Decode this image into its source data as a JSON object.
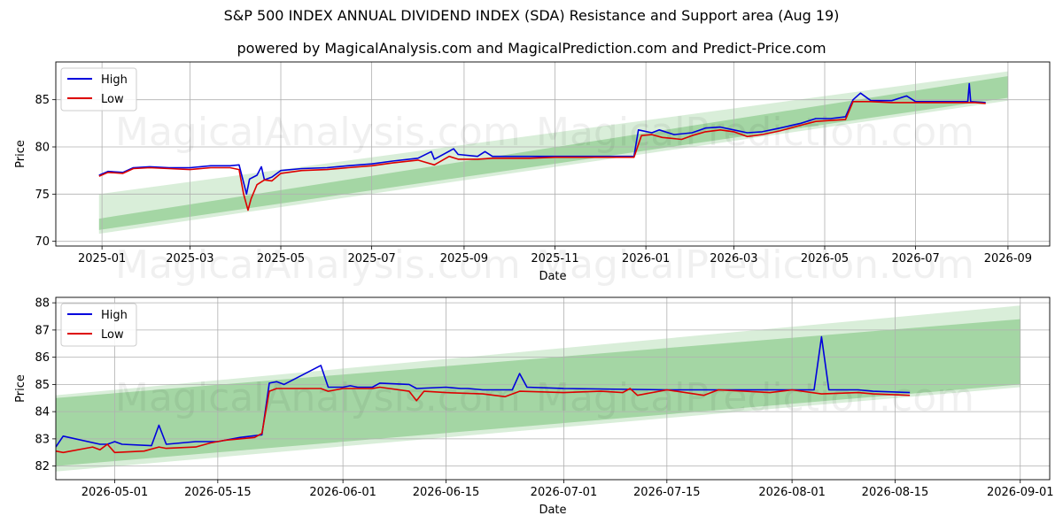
{
  "title": "S&P 500 INDEX ANNUAL DIVIDEND INDEX (SDA) Resistance and Support area (Aug 19)",
  "subtitle": "powered by MagicalAnalysis.com and MagicalPrediction.com and Predict-Price.com",
  "watermarks": [
    "MagicalAnalysis.com",
    "MagicalPrediction.com"
  ],
  "colors": {
    "high": "#0000dd",
    "low": "#dd0000",
    "band": "#2ca02c",
    "grid": "#b0b0b0"
  },
  "chart_data": [
    {
      "type": "line",
      "xlabel": "Date",
      "ylabel": "Price",
      "xlim": [
        "2024-12-01",
        "2026-09-29"
      ],
      "ylim": [
        69.5,
        89
      ],
      "xticks": [
        {
          "date": "2025-01-01",
          "label": "2025-01"
        },
        {
          "date": "2025-03-01",
          "label": "2025-03"
        },
        {
          "date": "2025-05-01",
          "label": "2025-05"
        },
        {
          "date": "2025-07-01",
          "label": "2025-07"
        },
        {
          "date": "2025-09-01",
          "label": "2025-09"
        },
        {
          "date": "2025-11-01",
          "label": "2025-11"
        },
        {
          "date": "2026-01-01",
          "label": "2026-01"
        },
        {
          "date": "2026-03-01",
          "label": "2026-03"
        },
        {
          "date": "2026-05-01",
          "label": "2026-05"
        },
        {
          "date": "2026-07-01",
          "label": "2026-07"
        },
        {
          "date": "2026-09-01",
          "label": "2026-09"
        }
      ],
      "yticks": [
        70,
        75,
        80,
        85
      ],
      "grid": true,
      "legend": "top-left",
      "bands": [
        {
          "x": [
            "2024-12-30",
            "2026-09-01"
          ],
          "upper": [
            75.0,
            88.0
          ],
          "lower": [
            70.8,
            84.9
          ],
          "opacity": 0.18
        },
        {
          "x": [
            "2024-12-30",
            "2026-09-01"
          ],
          "upper": [
            72.4,
            87.5
          ],
          "lower": [
            71.2,
            85.2
          ],
          "opacity": 0.3
        }
      ],
      "series": [
        {
          "name": "High",
          "points": [
            [
              "2024-12-30",
              77.0
            ],
            [
              "2025-01-05",
              77.4
            ],
            [
              "2025-01-15",
              77.3
            ],
            [
              "2025-01-22",
              77.8
            ],
            [
              "2025-02-02",
              77.9
            ],
            [
              "2025-02-15",
              77.8
            ],
            [
              "2025-03-01",
              77.8
            ],
            [
              "2025-03-15",
              78.0
            ],
            [
              "2025-03-28",
              78.0
            ],
            [
              "2025-04-03",
              78.1
            ],
            [
              "2025-04-08",
              75.0
            ],
            [
              "2025-04-10",
              76.6
            ],
            [
              "2025-04-15",
              77.0
            ],
            [
              "2025-04-18",
              77.9
            ],
            [
              "2025-04-20",
              76.5
            ],
            [
              "2025-04-25",
              76.8
            ],
            [
              "2025-05-01",
              77.5
            ],
            [
              "2025-05-15",
              77.7
            ],
            [
              "2025-06-01",
              77.8
            ],
            [
              "2025-06-15",
              78.0
            ],
            [
              "2025-07-01",
              78.2
            ],
            [
              "2025-07-15",
              78.5
            ],
            [
              "2025-08-01",
              78.8
            ],
            [
              "2025-08-10",
              79.5
            ],
            [
              "2025-08-12",
              78.7
            ],
            [
              "2025-08-25",
              79.8
            ],
            [
              "2025-08-28",
              79.2
            ],
            [
              "2025-09-10",
              79.0
            ],
            [
              "2025-09-15",
              79.5
            ],
            [
              "2025-09-20",
              79.0
            ],
            [
              "2025-10-15",
              79.0
            ],
            [
              "2025-11-01",
              79.0
            ],
            [
              "2025-11-15",
              79.0
            ],
            [
              "2025-12-01",
              79.0
            ],
            [
              "2025-12-15",
              79.0
            ],
            [
              "2025-12-24",
              79.0
            ],
            [
              "2025-12-27",
              81.8
            ],
            [
              "2026-01-05",
              81.5
            ],
            [
              "2026-01-10",
              81.8
            ],
            [
              "2026-01-20",
              81.3
            ],
            [
              "2026-02-01",
              81.5
            ],
            [
              "2026-02-10",
              82.0
            ],
            [
              "2026-02-20",
              82.1
            ],
            [
              "2026-03-01",
              81.8
            ],
            [
              "2026-03-10",
              81.5
            ],
            [
              "2026-03-20",
              81.6
            ],
            [
              "2026-04-01",
              82.0
            ],
            [
              "2026-04-15",
              82.5
            ],
            [
              "2026-04-25",
              83.0
            ],
            [
              "2026-05-05",
              83.0
            ],
            [
              "2026-05-15",
              83.2
            ],
            [
              "2026-05-20",
              85.0
            ],
            [
              "2026-05-25",
              85.7
            ],
            [
              "2026-06-01",
              84.9
            ],
            [
              "2026-06-15",
              84.9
            ],
            [
              "2026-06-25",
              85.4
            ],
            [
              "2026-07-01",
              84.8
            ],
            [
              "2026-07-15",
              84.8
            ],
            [
              "2026-08-01",
              84.8
            ],
            [
              "2026-08-05",
              84.8
            ],
            [
              "2026-08-06",
              86.7
            ],
            [
              "2026-08-07",
              84.8
            ],
            [
              "2026-08-17",
              84.7
            ]
          ]
        },
        {
          "name": "Low",
          "points": [
            [
              "2024-12-30",
              76.9
            ],
            [
              "2025-01-05",
              77.3
            ],
            [
              "2025-01-15",
              77.2
            ],
            [
              "2025-01-22",
              77.7
            ],
            [
              "2025-02-02",
              77.8
            ],
            [
              "2025-02-15",
              77.7
            ],
            [
              "2025-03-01",
              77.6
            ],
            [
              "2025-03-15",
              77.8
            ],
            [
              "2025-03-28",
              77.8
            ],
            [
              "2025-04-03",
              77.6
            ],
            [
              "2025-04-06",
              75.0
            ],
            [
              "2025-04-09",
              73.3
            ],
            [
              "2025-04-11",
              74.5
            ],
            [
              "2025-04-15",
              76.0
            ],
            [
              "2025-04-20",
              76.5
            ],
            [
              "2025-04-25",
              76.4
            ],
            [
              "2025-05-01",
              77.2
            ],
            [
              "2025-05-15",
              77.5
            ],
            [
              "2025-06-01",
              77.6
            ],
            [
              "2025-06-15",
              77.8
            ],
            [
              "2025-07-01",
              78.0
            ],
            [
              "2025-07-15",
              78.3
            ],
            [
              "2025-08-01",
              78.6
            ],
            [
              "2025-08-12",
              78.1
            ],
            [
              "2025-08-22",
              79.0
            ],
            [
              "2025-08-28",
              78.7
            ],
            [
              "2025-09-10",
              78.7
            ],
            [
              "2025-09-20",
              78.8
            ],
            [
              "2025-10-15",
              78.8
            ],
            [
              "2025-11-01",
              78.9
            ],
            [
              "2025-11-15",
              78.9
            ],
            [
              "2025-12-01",
              78.9
            ],
            [
              "2025-12-15",
              78.9
            ],
            [
              "2025-12-24",
              78.9
            ],
            [
              "2025-12-29",
              81.2
            ],
            [
              "2026-01-05",
              81.3
            ],
            [
              "2026-01-12",
              81.0
            ],
            [
              "2026-01-25",
              80.8
            ],
            [
              "2026-02-01",
              81.2
            ],
            [
              "2026-02-10",
              81.6
            ],
            [
              "2026-02-20",
              81.8
            ],
            [
              "2026-03-01",
              81.6
            ],
            [
              "2026-03-10",
              81.1
            ],
            [
              "2026-03-20",
              81.3
            ],
            [
              "2026-04-01",
              81.7
            ],
            [
              "2026-04-15",
              82.3
            ],
            [
              "2026-04-25",
              82.7
            ],
            [
              "2026-05-05",
              82.8
            ],
            [
              "2026-05-15",
              82.9
            ],
            [
              "2026-05-20",
              84.8
            ],
            [
              "2026-06-01",
              84.8
            ],
            [
              "2026-06-15",
              84.7
            ],
            [
              "2026-07-01",
              84.7
            ],
            [
              "2026-07-15",
              84.7
            ],
            [
              "2026-08-01",
              84.7
            ],
            [
              "2026-08-10",
              84.7
            ],
            [
              "2026-08-17",
              84.6
            ]
          ]
        }
      ]
    },
    {
      "type": "line",
      "xlabel": "Date",
      "ylabel": "Price",
      "xlim": [
        "2026-04-23",
        "2026-09-05"
      ],
      "ylim": [
        81.5,
        88.2
      ],
      "xticks": [
        {
          "date": "2026-05-01",
          "label": "2026-05-01"
        },
        {
          "date": "2026-05-15",
          "label": "2026-05-15"
        },
        {
          "date": "2026-06-01",
          "label": "2026-06-01"
        },
        {
          "date": "2026-06-15",
          "label": "2026-06-15"
        },
        {
          "date": "2026-07-01",
          "label": "2026-07-01"
        },
        {
          "date": "2026-07-15",
          "label": "2026-07-15"
        },
        {
          "date": "2026-08-01",
          "label": "2026-08-01"
        },
        {
          "date": "2026-08-15",
          "label": "2026-08-15"
        },
        {
          "date": "2026-09-01",
          "label": "2026-09-01"
        }
      ],
      "yticks": [
        82,
        83,
        84,
        85,
        86,
        87,
        88
      ],
      "grid": true,
      "legend": "top-left",
      "bands": [
        {
          "x": [
            "2026-04-23",
            "2026-09-01"
          ],
          "upper": [
            84.6,
            87.9
          ],
          "lower": [
            81.8,
            84.9
          ],
          "opacity": 0.18
        },
        {
          "x": [
            "2026-04-23",
            "2026-09-01"
          ],
          "upper": [
            84.5,
            87.4
          ],
          "lower": [
            82.0,
            85.0
          ],
          "opacity": 0.3
        }
      ],
      "series": [
        {
          "name": "High",
          "points": [
            [
              "2026-04-23",
              82.7
            ],
            [
              "2026-04-24",
              83.1
            ],
            [
              "2026-04-29",
              82.8
            ],
            [
              "2026-04-30",
              82.8
            ],
            [
              "2026-05-01",
              82.9
            ],
            [
              "2026-05-02",
              82.8
            ],
            [
              "2026-05-06",
              82.75
            ],
            [
              "2026-05-07",
              83.5
            ],
            [
              "2026-05-08",
              82.8
            ],
            [
              "2026-05-12",
              82.9
            ],
            [
              "2026-05-15",
              82.9
            ],
            [
              "2026-05-18",
              83.05
            ],
            [
              "2026-05-21",
              83.15
            ],
            [
              "2026-05-22",
              85.05
            ],
            [
              "2026-05-23",
              85.1
            ],
            [
              "2026-05-24",
              85.0
            ],
            [
              "2026-05-29",
              85.7
            ],
            [
              "2026-05-30",
              84.9
            ],
            [
              "2026-06-01",
              84.9
            ],
            [
              "2026-06-02",
              84.95
            ],
            [
              "2026-06-03",
              84.9
            ],
            [
              "2026-06-05",
              84.9
            ],
            [
              "2026-06-06",
              85.05
            ],
            [
              "2026-06-10",
              85.0
            ],
            [
              "2026-06-11",
              84.85
            ],
            [
              "2026-06-15",
              84.9
            ],
            [
              "2026-06-17",
              84.85
            ],
            [
              "2026-06-18",
              84.85
            ],
            [
              "2026-06-20",
              84.8
            ],
            [
              "2026-06-24",
              84.8
            ],
            [
              "2026-06-25",
              85.4
            ],
            [
              "2026-06-26",
              84.9
            ],
            [
              "2026-07-01",
              84.85
            ],
            [
              "2026-07-15",
              84.8
            ],
            [
              "2026-08-01",
              84.8
            ],
            [
              "2026-08-04",
              84.8
            ],
            [
              "2026-08-05",
              86.75
            ],
            [
              "2026-08-06",
              84.8
            ],
            [
              "2026-08-10",
              84.8
            ],
            [
              "2026-08-12",
              84.75
            ],
            [
              "2026-08-17",
              84.7
            ]
          ]
        },
        {
          "name": "Low",
          "points": [
            [
              "2026-04-23",
              82.55
            ],
            [
              "2026-04-24",
              82.5
            ],
            [
              "2026-04-28",
              82.7
            ],
            [
              "2026-04-29",
              82.6
            ],
            [
              "2026-04-30",
              82.8
            ],
            [
              "2026-05-01",
              82.5
            ],
            [
              "2026-05-05",
              82.55
            ],
            [
              "2026-05-07",
              82.7
            ],
            [
              "2026-05-08",
              82.65
            ],
            [
              "2026-05-12",
              82.7
            ],
            [
              "2026-05-14",
              82.85
            ],
            [
              "2026-05-16",
              82.95
            ],
            [
              "2026-05-20",
              83.05
            ],
            [
              "2026-05-21",
              83.2
            ],
            [
              "2026-05-22",
              84.75
            ],
            [
              "2026-05-23",
              84.85
            ],
            [
              "2026-05-29",
              84.85
            ],
            [
              "2026-05-30",
              84.75
            ],
            [
              "2026-06-01",
              84.85
            ],
            [
              "2026-06-05",
              84.85
            ],
            [
              "2026-06-06",
              84.9
            ],
            [
              "2026-06-10",
              84.75
            ],
            [
              "2026-06-11",
              84.4
            ],
            [
              "2026-06-12",
              84.75
            ],
            [
              "2026-06-15",
              84.7
            ],
            [
              "2026-06-20",
              84.65
            ],
            [
              "2026-06-23",
              84.55
            ],
            [
              "2026-06-25",
              84.75
            ],
            [
              "2026-07-01",
              84.7
            ],
            [
              "2026-07-06",
              84.75
            ],
            [
              "2026-07-09",
              84.7
            ],
            [
              "2026-07-10",
              84.85
            ],
            [
              "2026-07-11",
              84.6
            ],
            [
              "2026-07-15",
              84.8
            ],
            [
              "2026-07-20",
              84.6
            ],
            [
              "2026-07-22",
              84.8
            ],
            [
              "2026-07-29",
              84.7
            ],
            [
              "2026-08-01",
              84.8
            ],
            [
              "2026-08-05",
              84.65
            ],
            [
              "2026-08-10",
              84.7
            ],
            [
              "2026-08-12",
              84.65
            ],
            [
              "2026-08-17",
              84.6
            ]
          ]
        }
      ]
    }
  ]
}
